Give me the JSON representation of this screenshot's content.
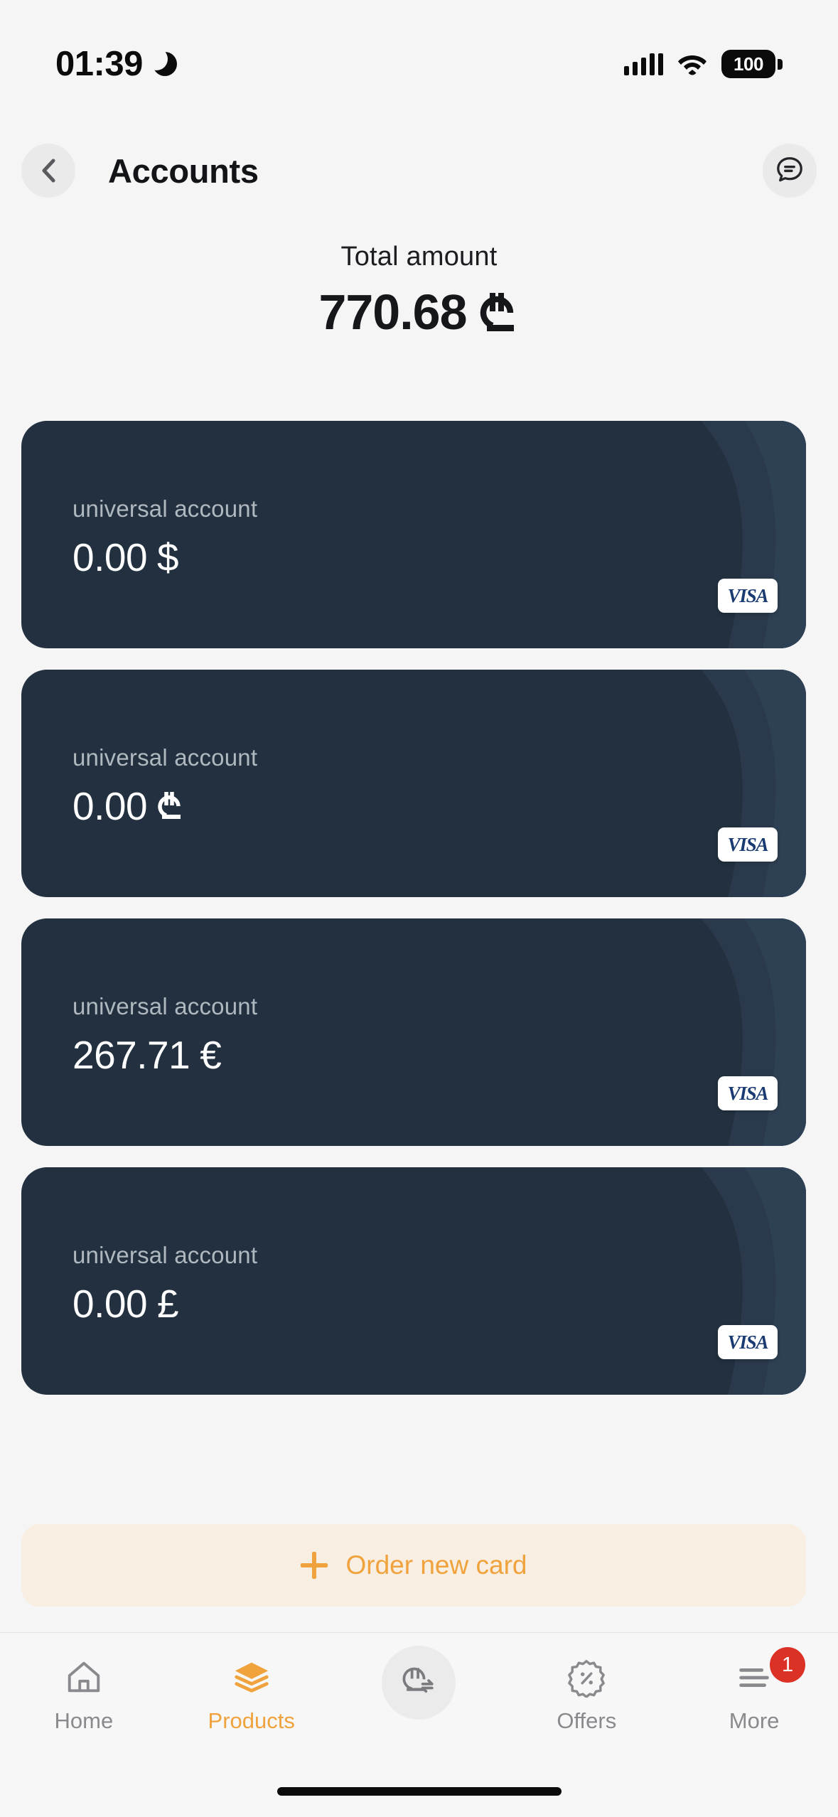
{
  "status_bar": {
    "time": "01:39",
    "dnd_icon": "moon-icon",
    "signal_icon": "signal-bars-icon",
    "wifi_icon": "wifi-icon",
    "battery_level": "100"
  },
  "header": {
    "back_icon": "chevron-left-icon",
    "title": "Accounts",
    "chat_icon": "chat-bubble-icon"
  },
  "total": {
    "label": "Total amount",
    "value": "770.68",
    "currency_icon": "lari-icon"
  },
  "accounts": [
    {
      "label": "universal account",
      "amount": "0.00",
      "currency": "$",
      "currency_icon": "dollar-symbol",
      "network": "VISA"
    },
    {
      "label": "universal account",
      "amount": "0.00",
      "currency": "₾",
      "currency_icon": "lari-icon",
      "network": "VISA"
    },
    {
      "label": "universal account",
      "amount": "267.71",
      "currency": "€",
      "currency_icon": "euro-symbol",
      "network": "VISA"
    },
    {
      "label": "universal account",
      "amount": "0.00",
      "currency": "£",
      "currency_icon": "pound-symbol",
      "network": "VISA"
    }
  ],
  "order_card": {
    "plus_icon": "plus-icon",
    "label": "Order new card",
    "accent_color": "#F0A23C",
    "background_color": "#F8EEE1"
  },
  "bottom_nav": {
    "items": [
      {
        "label": "Home",
        "icon": "home-icon",
        "active": false
      },
      {
        "label": "Products",
        "icon": "layers-icon",
        "active": true
      },
      {
        "label": "",
        "icon": "transfer-lari-icon",
        "active": false
      },
      {
        "label": "Offers",
        "icon": "discount-percent-icon",
        "active": false
      },
      {
        "label": "More",
        "icon": "menu-lines-icon",
        "active": false,
        "badge": "1"
      }
    ]
  },
  "colors": {
    "page_background": "#F5F5F6",
    "card_background": "#22303F",
    "accent": "#F0A23C",
    "badge_red": "#DC3226"
  }
}
